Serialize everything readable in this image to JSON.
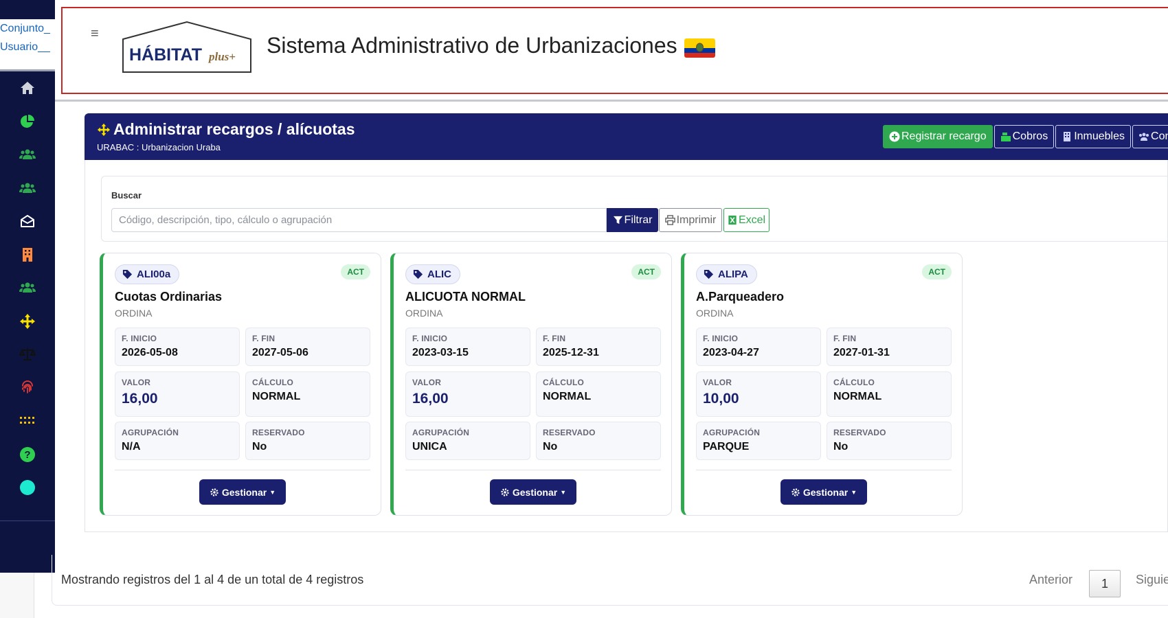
{
  "sidebar": {
    "links": [
      "Conjunto_",
      "Usuario__"
    ],
    "icons": [
      {
        "name": "home-icon",
        "color": "#cfd3dc"
      },
      {
        "name": "pie-chart-icon",
        "color": "#2fd04f"
      },
      {
        "name": "users-icon",
        "color": "#2fa84f"
      },
      {
        "name": "users-group-icon",
        "color": "#2fa84f"
      },
      {
        "name": "envelope-open-icon",
        "color": "#ffffff"
      },
      {
        "name": "building-icon",
        "color": "#ff8a3d"
      },
      {
        "name": "users-alt-icon",
        "color": "#2fa84f"
      },
      {
        "name": "arrows-move-icon",
        "color": "#f7e000"
      },
      {
        "name": "scale-icon",
        "color": "#111111"
      },
      {
        "name": "fingerprint-icon",
        "color": "#e53935"
      },
      {
        "name": "grid-dots-icon",
        "color": "#f7c000"
      },
      {
        "name": "help-icon",
        "color": "#2fd04f"
      },
      {
        "name": "circle-icon",
        "color": "#1de9d0"
      }
    ]
  },
  "header": {
    "logo_text": "HÁBITAT",
    "logo_script": "plus+",
    "title": "Sistema Administrativo de Urbanizaciones"
  },
  "panel": {
    "title": "Administrar recargos / alícuotas",
    "subtitle": "URABAC : Urbanizacion Uraba",
    "buttons": {
      "register": "Registrar recargo",
      "charges": "Cobros",
      "properties": "Inmuebles",
      "owners": "Condo"
    }
  },
  "search": {
    "label": "Buscar",
    "placeholder": "Código, descripción, tipo, cálculo o agrupación",
    "filter": "Filtrar",
    "print": "Imprimir",
    "excel": "Excel"
  },
  "labels": {
    "start": "F. INICIO",
    "end": "F. FIN",
    "value": "VALOR",
    "calc": "CÁLCULO",
    "group": "AGRUPACIÓN",
    "reserved": "RESERVADO",
    "manage": "Gestionar"
  },
  "cards": [
    {
      "code": "ALI00a",
      "status": "ACT",
      "name": "Cuotas Ordinarias",
      "type": "ORDINA",
      "start": "2026-05-08",
      "end": "2027-05-06",
      "value": "16,00",
      "calc": "NORMAL",
      "group": "N/A",
      "reserved": "No"
    },
    {
      "code": "ALIC",
      "status": "ACT",
      "name": "ALICUOTA NORMAL",
      "type": "ORDINA",
      "start": "2023-03-15",
      "end": "2025-12-31",
      "value": "16,00",
      "calc": "NORMAL",
      "group": "UNICA",
      "reserved": "No"
    },
    {
      "code": "ALIPA",
      "status": "ACT",
      "name": "A.Parqueadero",
      "type": "ORDINA",
      "start": "2023-04-27",
      "end": "2027-01-31",
      "value": "10,00",
      "calc": "NORMAL",
      "group": "PARQUE",
      "reserved": "No"
    }
  ],
  "footer": {
    "records": "Mostrando registros del 1 al 4 de un total de 4 registros",
    "prev": "Anterior",
    "page": "1",
    "next": "Siguie"
  },
  "colors": {
    "navy": "#1a1f6e",
    "sidebar": "#0d1440",
    "success": "#2fa84f",
    "header_border": "#c62828"
  }
}
